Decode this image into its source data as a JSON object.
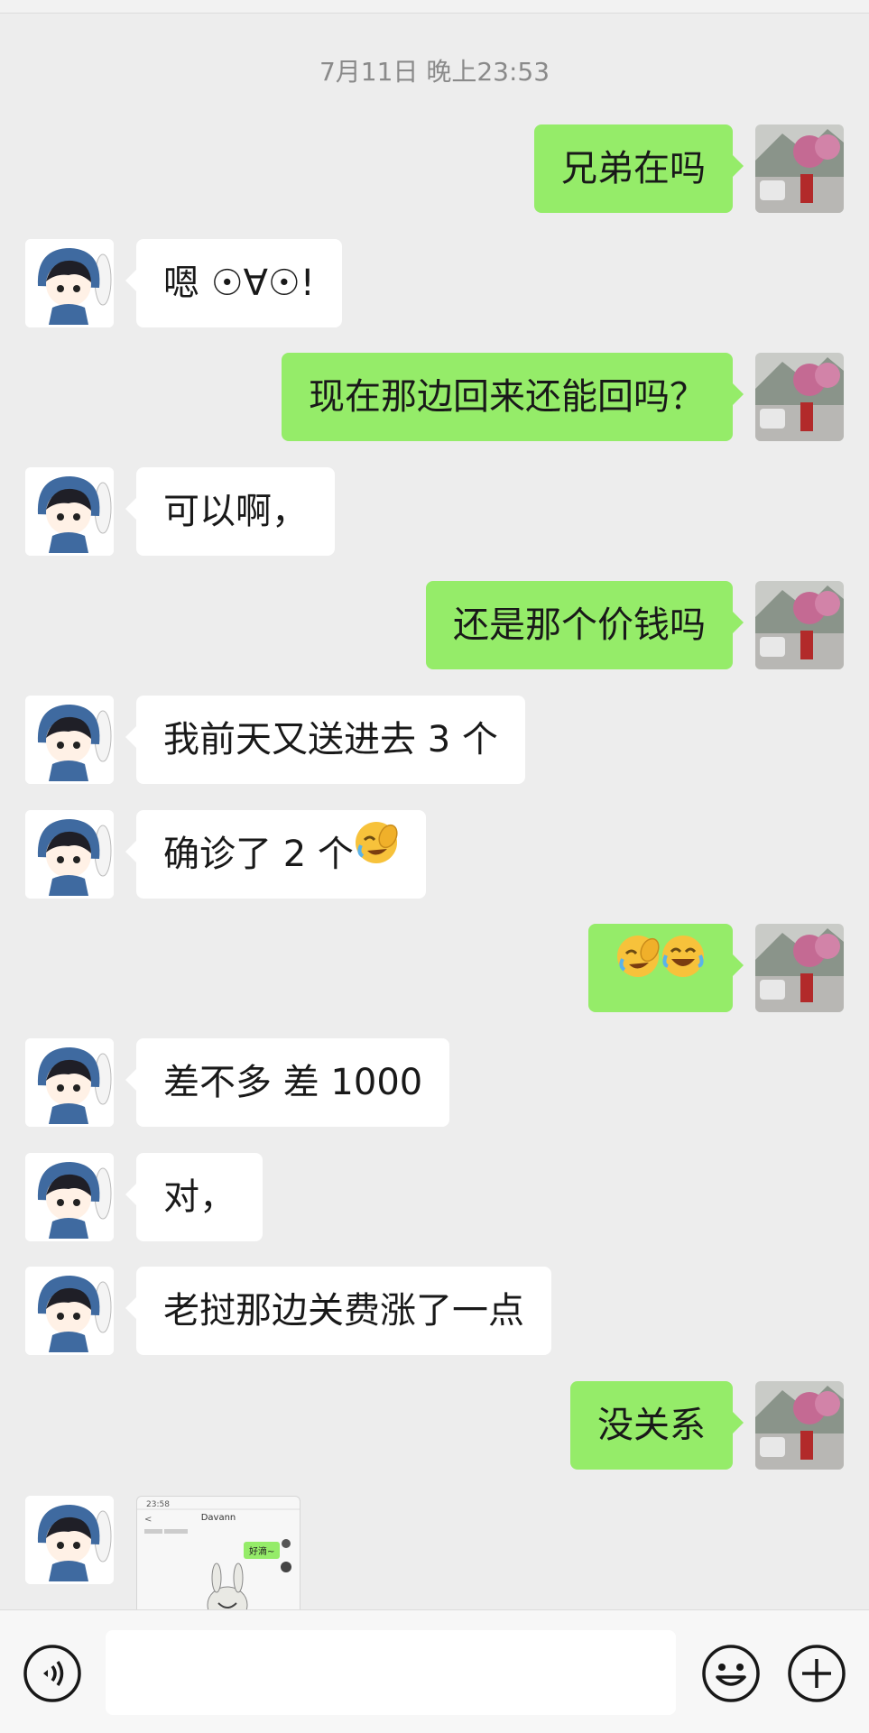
{
  "chat": {
    "timestamp": "7月11日 晚上23:53",
    "messages": [
      {
        "side": "right",
        "text": "兄弟在吗"
      },
      {
        "side": "left",
        "text": "嗯 ☉∀☉!"
      },
      {
        "side": "right",
        "text": "现在那边回来还能回吗？"
      },
      {
        "side": "left",
        "text": "可以啊，"
      },
      {
        "side": "right",
        "text": "还是那个价钱吗"
      },
      {
        "side": "left",
        "text": "我前天又送进去 3 个"
      },
      {
        "side": "left",
        "text": "确诊了 2 个",
        "emoji": "facepalm-laugh"
      },
      {
        "side": "right",
        "text": "",
        "emoji": "facepalm-laugh, tears-of-joy"
      },
      {
        "side": "left",
        "text": "差不多 差 1000"
      },
      {
        "side": "left",
        "text": "对，"
      },
      {
        "side": "left",
        "text": "老挝那边关费涨了一点"
      },
      {
        "side": "right",
        "text": "没关系"
      }
    ],
    "image_message": {
      "time_text": "23:58",
      "title_text": "Davann",
      "bubble_text": "好滴~"
    }
  },
  "input_bar": {
    "voice_icon": "voice-icon",
    "emoji_icon": "emoji-icon",
    "plus_icon": "plus-icon",
    "input_value": ""
  },
  "colors": {
    "background": "#ededed",
    "sent_bubble": "#95ec69",
    "received_bubble": "#ffffff",
    "timestamp": "#8a8a8a"
  }
}
